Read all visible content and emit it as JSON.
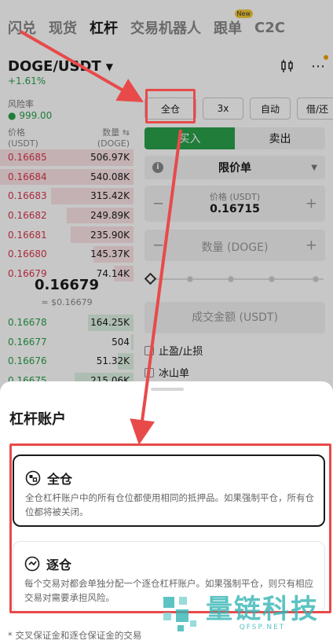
{
  "nav": {
    "tabs": [
      "闪兑",
      "现货",
      "杠杆",
      "交易机器人",
      "跟单",
      "C2C"
    ],
    "active": "杠杆",
    "new_badge": "New"
  },
  "pair": {
    "name": "DOGE/USDT",
    "change": "+1.61%"
  },
  "risk": {
    "label": "风险率",
    "value": "999.00"
  },
  "orderbook": {
    "price_header": "价格",
    "price_unit": "(USDT)",
    "qty_header": "数量 ⇆",
    "qty_unit": "(DOGE)",
    "asks": [
      {
        "price": "0.16685",
        "qty": "506.97K",
        "depth": 1.0
      },
      {
        "price": "0.16684",
        "qty": "540.08K",
        "depth": 1.0
      },
      {
        "price": "0.16683",
        "qty": "315.42K",
        "depth": 0.62
      },
      {
        "price": "0.16682",
        "qty": "249.89K",
        "depth": 0.5
      },
      {
        "price": "0.16681",
        "qty": "235.90K",
        "depth": 0.47
      },
      {
        "price": "0.16680",
        "qty": "145.37K",
        "depth": 0.3
      },
      {
        "price": "0.16679",
        "qty": "74.14K",
        "depth": 0.15
      }
    ],
    "mid_price": "0.16679",
    "mid_usd": "≈ $0.16679",
    "bids": [
      {
        "price": "0.16678",
        "qty": "164.25K",
        "depth": 0.34
      },
      {
        "price": "0.16677",
        "qty": "504",
        "depth": 0.02
      },
      {
        "price": "0.16676",
        "qty": "51.32K",
        "depth": 0.12
      },
      {
        "price": "0.16675",
        "qty": "215.06K",
        "depth": 0.44
      }
    ]
  },
  "trade": {
    "modes": [
      "全仓",
      "3x",
      "自动",
      "借/还"
    ],
    "buy": "买入",
    "sell": "卖出",
    "order_type": "限价单",
    "price_label": "价格 (USDT)",
    "price_value": "0.16715",
    "qty_placeholder": "数量 (DOGE)",
    "slider_pct": 0,
    "amount_placeholder": "成交金额 (USDT)",
    "tp_sl": "止盈/止损",
    "iceberg": "冰山单"
  },
  "sheet": {
    "title": "杠杆账户",
    "options": [
      {
        "title": "全仓",
        "desc": "全仓杠杆账户中的所有仓位都使用相同的抵押品。如果强制平仓，所有仓位都将被关闭。"
      },
      {
        "title": "逐仓",
        "desc": "每个交易对都会单独分配一个逐仓杠杆账户。如果强制平仓，则只有相应交易对需要承担风险。"
      }
    ],
    "footnote": "* 交叉保证金和逐仓保证金的交易"
  },
  "watermark": {
    "name": "量链科技",
    "site": "QFSP.NET"
  },
  "colors": {
    "green": "#2aa14b",
    "red": "#d9364d",
    "annotation": "#e84a4a"
  }
}
